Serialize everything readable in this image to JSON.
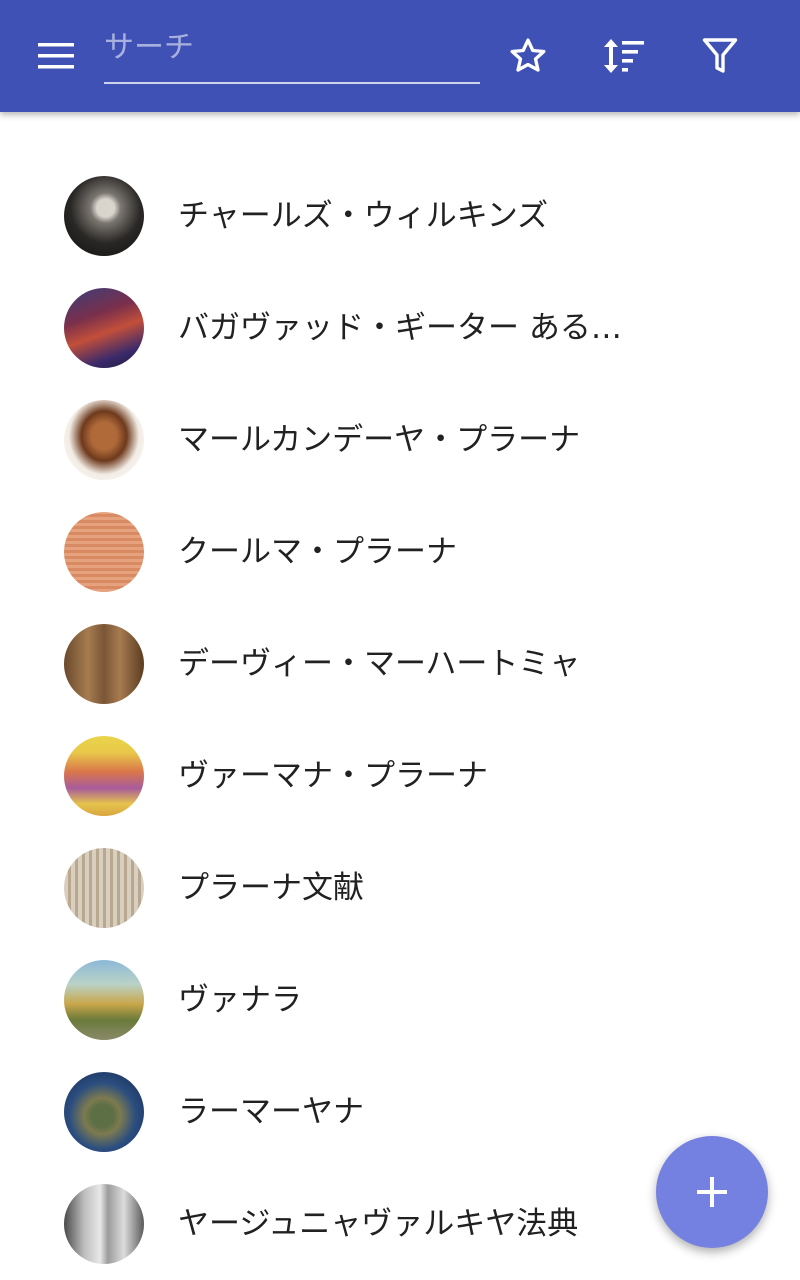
{
  "app_bar": {
    "background": "#3f51b5",
    "icons": {
      "menu": "menu-icon",
      "favorite": "star-outline-icon",
      "sort": "sort-icon",
      "filter": "filter-icon"
    }
  },
  "search": {
    "placeholder": "サーチ",
    "value": ""
  },
  "list": {
    "items": [
      {
        "label": "チャールズ・ウィルキンズ"
      },
      {
        "label": "バガヴァッド・ギーター ある…"
      },
      {
        "label": "マールカンデーヤ・プラーナ"
      },
      {
        "label": "クールマ・プラーナ"
      },
      {
        "label": "デーヴィー・マーハートミャ"
      },
      {
        "label": "ヴァーマナ・プラーナ"
      },
      {
        "label": "プラーナ文献"
      },
      {
        "label": "ヴァナラ"
      },
      {
        "label": "ラーマーヤナ"
      },
      {
        "label": "ヤージュニャヴァルキヤ法典"
      }
    ]
  },
  "fab": {
    "icon": "plus-icon",
    "color": "#7581e0"
  }
}
